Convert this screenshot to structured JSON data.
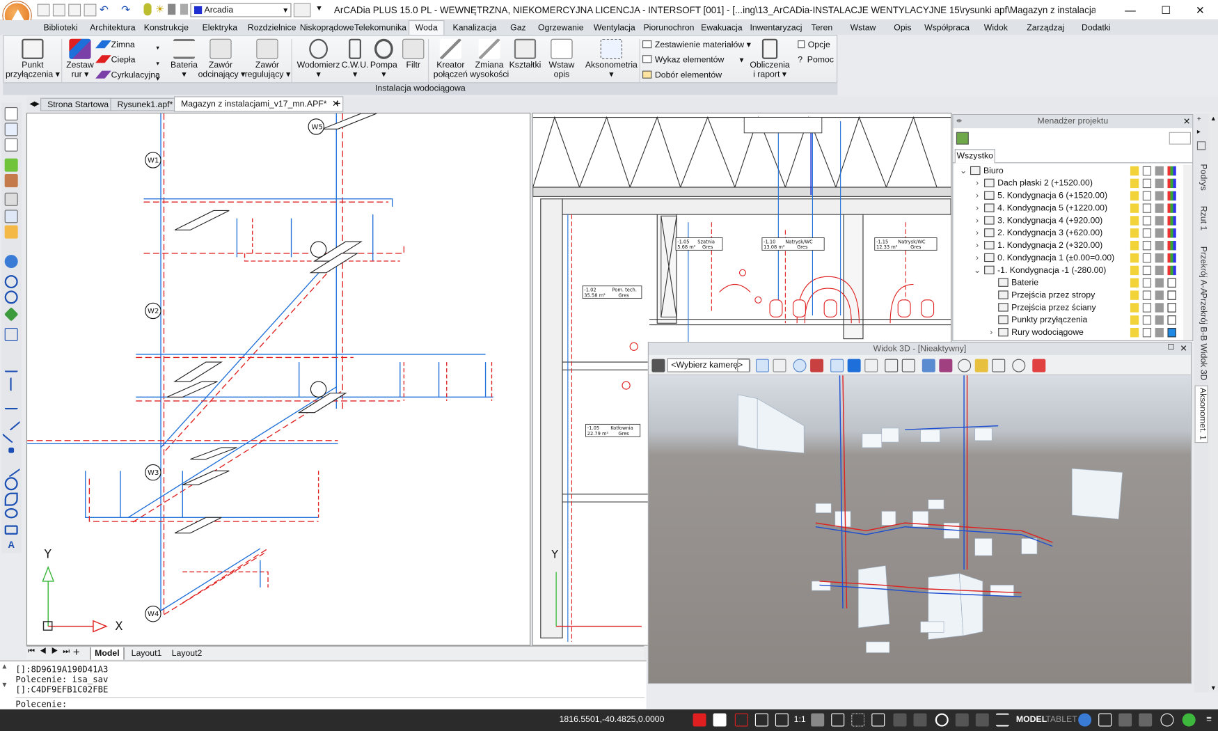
{
  "title_bar": {
    "title": "ArCADia PLUS 15.0 PL - WEWNĘTRZNA, NIEKOMERCYJNA LICENCJA - INTERSOFT [001] - [...ing\\13_ArCADia-INSTALACJE WENTYLACYJNE 15\\rysunki apf\\Magazyn z instalacjami]",
    "layer": "Arcadia",
    "minimize": "—",
    "maximize": "☐",
    "close": "✕"
  },
  "ribbon_tabs": [
    "Biblioteki",
    "Architektura",
    "Konstrukcje",
    "Elektryka",
    "Rozdzielnice",
    "Niskoprądowe",
    "Telekomunika",
    "Woda",
    "Kanalizacja",
    "Gaz",
    "Ogrzewanie",
    "Wentylacja",
    "Piorunochron",
    "Ewakuacja",
    "Inwentaryzacj",
    "Teren",
    "Wstaw",
    "Opis",
    "Współpraca",
    "Widok",
    "Zarządzaj",
    "Dodatki"
  ],
  "ribbon": {
    "punkt": "Punkt\nprzyłączenia ▾",
    "zestaw": "Zestaw\nrur ▾",
    "pipes": [
      "Zimna",
      "Ciepła",
      "Cyrkulacyjna"
    ],
    "bateria": "Bateria\n▾",
    "zawor_odc": "Zawór\nodcinający ▾",
    "zawor_reg": "Zawór\nregulujący ▾",
    "wodomierz": "Wodomierz\n▾",
    "cwu": "C.W.U.\n▾",
    "pompa": "Pompa\n▾",
    "filtr": "Filtr",
    "kreator": "Kreator\npołączeń",
    "zmiana": "Zmiana\nwysokości",
    "ksztaltki": "Kształtki",
    "wstaw_opis": "Wstaw\nopis",
    "akso": "Aksonometria\n▾",
    "zestawienie": "Zestawienie materiałów ▾",
    "wykaz": "Wykaz elementów",
    "dobor": "Dobór elementów",
    "obliczenia": "Obliczenia\ni raport ▾",
    "opcje": "Opcje",
    "pomoc": "Pomoc",
    "group_label": "Instalacja wodociągowa"
  },
  "doc_tabs": [
    "Strona Startowa",
    "Rysunek1.apf*",
    "Magazyn z instalacjami_v17_mn.APF*"
  ],
  "layout_tabs": [
    "Model",
    "Layout1",
    "Layout2"
  ],
  "axis": {
    "x": "X",
    "y": "Y"
  },
  "command": {
    "lines": [
      "[]:8D9619A190D41A3",
      "Polecenie: isa_sav",
      "[]:C4DF9EFB1C02FBE",
      "Polecenie:"
    ]
  },
  "status": {
    "coords": "1816.5501,-40.4825,0.0000",
    "scale": "1:1",
    "model": "MODEL",
    "tablet": "TABLET"
  },
  "project_manager": {
    "title": "Menadżer projektu",
    "tab": "Wszystko",
    "tree": [
      {
        "label": "Biuro",
        "level": 0,
        "exp": "⌄"
      },
      {
        "label": "Dach płaski 2 (+1520.00)",
        "level": 1,
        "exp": "›"
      },
      {
        "label": "5. Kondygnacja 6 (+1520.00)",
        "level": 1,
        "exp": "›"
      },
      {
        "label": "4. Kondygnacja 5 (+1220.00)",
        "level": 1,
        "exp": "›"
      },
      {
        "label": "3. Kondygnacja 4 (+920.00)",
        "level": 1,
        "exp": "›"
      },
      {
        "label": "2. Kondygnacja 3 (+620.00)",
        "level": 1,
        "exp": "›"
      },
      {
        "label": "1. Kondygnacja 2 (+320.00)",
        "level": 1,
        "exp": "›"
      },
      {
        "label": "0. Kondygnacja 1 (±0.00=0.00)",
        "level": 1,
        "exp": "›"
      },
      {
        "label": "-1. Kondygnacja -1 (-280.00)",
        "level": 1,
        "exp": "⌄"
      },
      {
        "label": "Baterie",
        "level": 2,
        "exp": ""
      },
      {
        "label": "Przejścia przez stropy",
        "level": 2,
        "exp": ""
      },
      {
        "label": "Przejścia przez ściany",
        "level": 2,
        "exp": ""
      },
      {
        "label": "Punkty przyłączenia",
        "level": 2,
        "exp": ""
      },
      {
        "label": "Rury wodociągowe",
        "level": 2,
        "exp": "›"
      }
    ]
  },
  "view3d": {
    "title": "Widok 3D - [Nieaktywny]",
    "camera": "<Wybierz kamerę>"
  },
  "side_tabs": [
    "Podrys",
    "Rzut 1",
    "Przekrój A-A",
    "Przekrój B-B",
    "Widok 3D",
    "Aksonomet. 1"
  ],
  "room_labels": [
    {
      "no": "-1.02",
      "name": "Pom. tech.",
      "area": "35.58 m²",
      "floor": "Gres"
    },
    {
      "no": "-1.05",
      "name": "Kotłownia",
      "area": "22.79 m²",
      "floor": "Gres"
    },
    {
      "no": "-1.05",
      "name": "Szatnia",
      "area": "5.68 m²",
      "floor": "Gres"
    },
    {
      "no": "-1.10",
      "name": "Natrysk/WC",
      "area": "13.08 m²",
      "floor": "Gres"
    },
    {
      "no": "-1.15",
      "name": "Natrysk/WC",
      "area": "12.33 m²",
      "floor": "Gres"
    }
  ],
  "iso_labels": [
    "W1",
    "W2",
    "W3",
    "W4",
    "W5"
  ],
  "colors": {
    "cold": "#1e6fd9",
    "hot": "#e02020",
    "accent": "#1f2fd0"
  }
}
